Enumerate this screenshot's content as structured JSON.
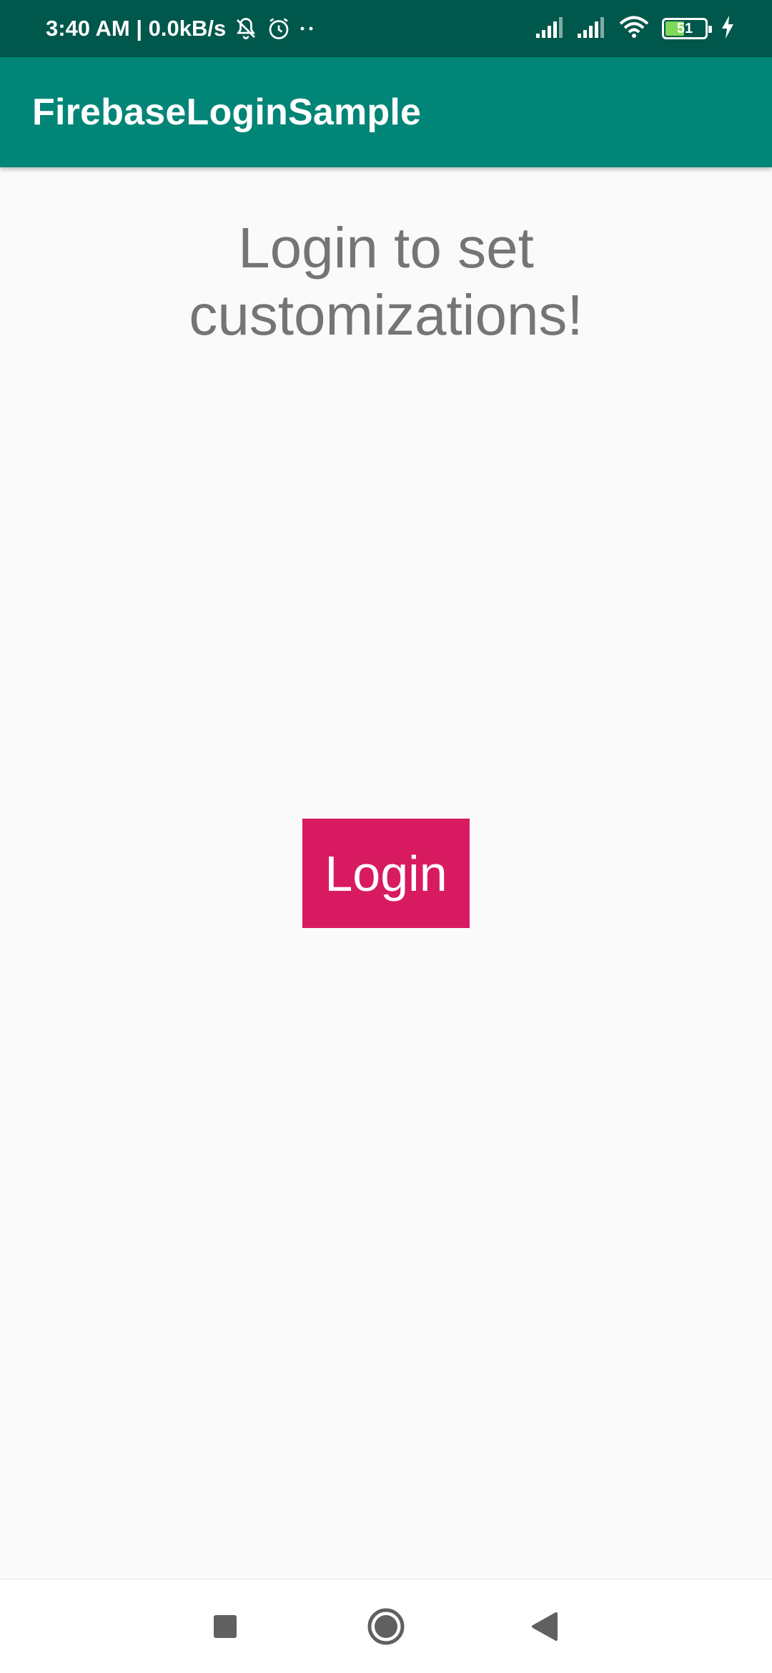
{
  "status_bar": {
    "time_speed": "3:40 AM | 0.0kB/s",
    "battery_level": "51",
    "battery_fraction": 0.51,
    "icons": [
      "mute-icon",
      "alarm-icon",
      "more-dots-icon",
      "signal-icon",
      "signal-icon",
      "wifi-icon",
      "battery-icon",
      "charging-icon"
    ]
  },
  "app_bar": {
    "title": "FirebaseLoginSample"
  },
  "main": {
    "headline": "Login to set customizations!",
    "login_button_label": "Login"
  },
  "nav_bar": {
    "buttons": [
      "recents",
      "home",
      "back"
    ]
  },
  "colors": {
    "status_bar": "#00574b",
    "app_bar": "#008577",
    "accent": "#d81b60",
    "background": "#fafafa",
    "headline_text": "#757575"
  }
}
